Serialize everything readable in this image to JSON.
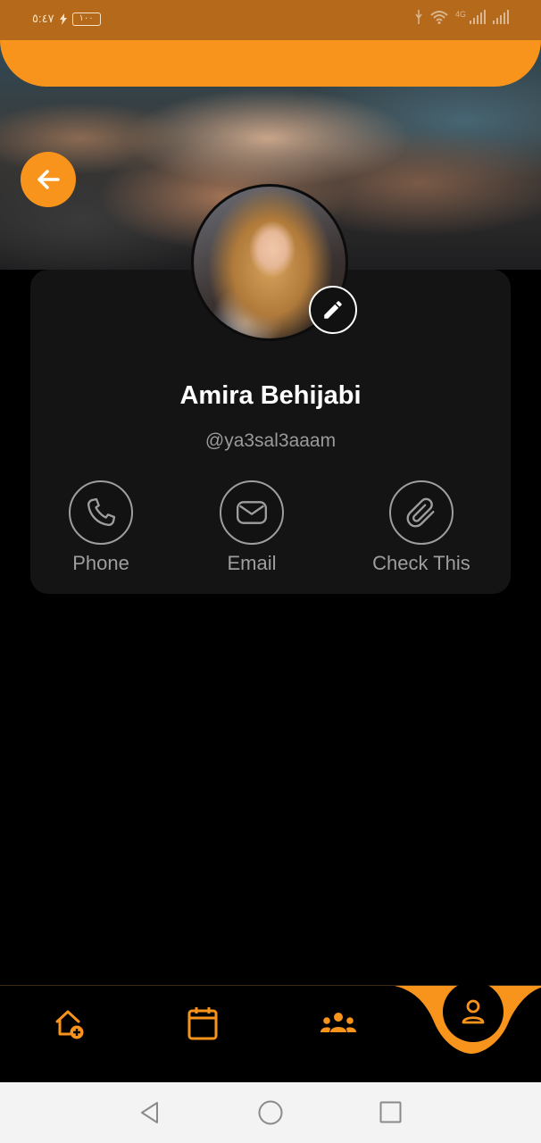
{
  "status_bar": {
    "time": "٥:٤٧",
    "battery": "١٠٠",
    "network": "4G"
  },
  "profile": {
    "name": "Amira Behijabi",
    "handle": "@ya3sal3aaam"
  },
  "actions": [
    {
      "label": "Phone",
      "icon": "phone-icon"
    },
    {
      "label": "Email",
      "icon": "email-icon"
    },
    {
      "label": "Check This",
      "icon": "paperclip-icon"
    }
  ],
  "bottom_nav": {
    "items": [
      "add-home-icon",
      "calendar-icon",
      "groups-icon",
      "person-icon"
    ],
    "active": "person-icon"
  },
  "colors": {
    "accent": "#f8941c",
    "card": "#141414",
    "background": "#000000",
    "muted_text": "#9e9e9e"
  }
}
